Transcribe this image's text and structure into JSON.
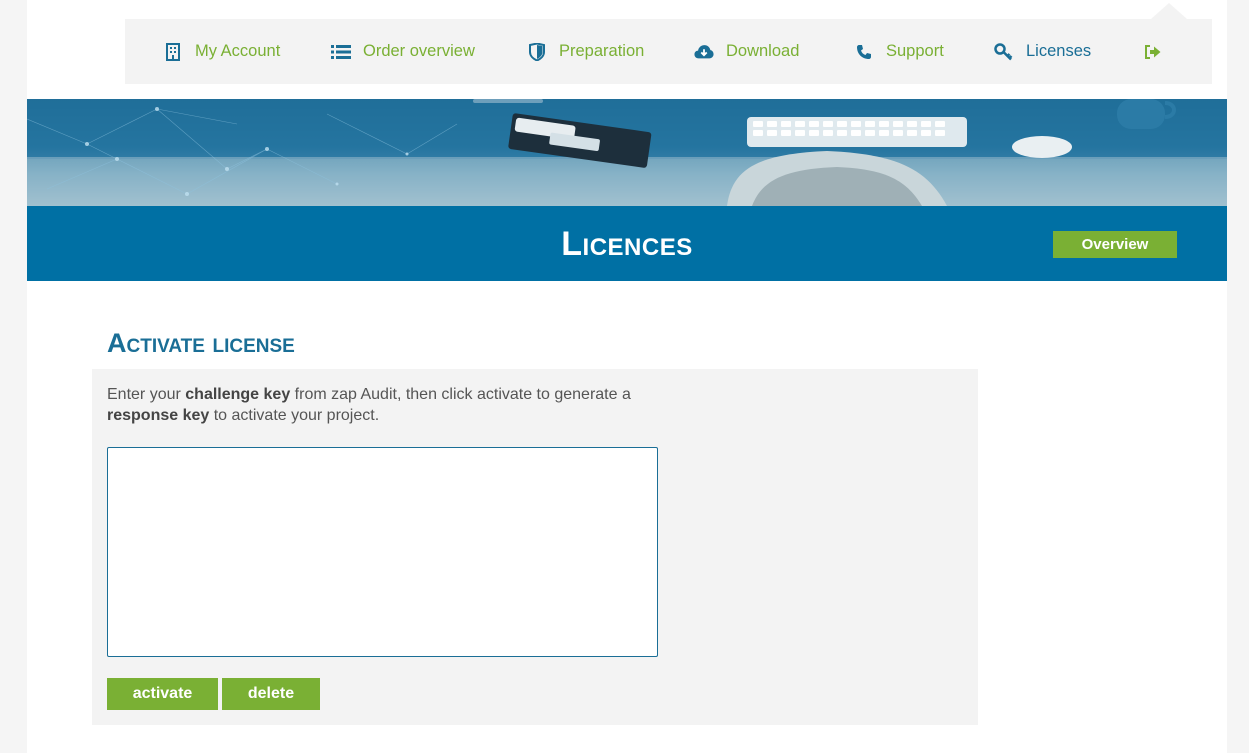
{
  "nav": {
    "items": [
      {
        "label": "My Account",
        "icon": "building-icon"
      },
      {
        "label": "Order overview",
        "icon": "list-icon"
      },
      {
        "label": "Preparation",
        "icon": "shield-icon"
      },
      {
        "label": "Download",
        "icon": "cloud-download-icon"
      },
      {
        "label": "Support",
        "icon": "phone-icon"
      },
      {
        "label": "Licenses",
        "icon": "key-icon"
      }
    ],
    "logout_icon": "sign-out-icon"
  },
  "header": {
    "title": "Licences",
    "overview_label": "Overview"
  },
  "section": {
    "title": "Activate license",
    "desc_part1": "Enter your ",
    "desc_bold1": "challenge key",
    "desc_part2": " from zap Audit, then click activate to generate a ",
    "desc_bold2": "response key",
    "desc_part3": " to activate your project.",
    "textarea_value": ""
  },
  "buttons": {
    "activate": "activate",
    "delete": "delete"
  },
  "colors": {
    "accent_green": "#7ab034",
    "brand_blue": "#0070a4",
    "text_blue": "#1a6e96"
  }
}
